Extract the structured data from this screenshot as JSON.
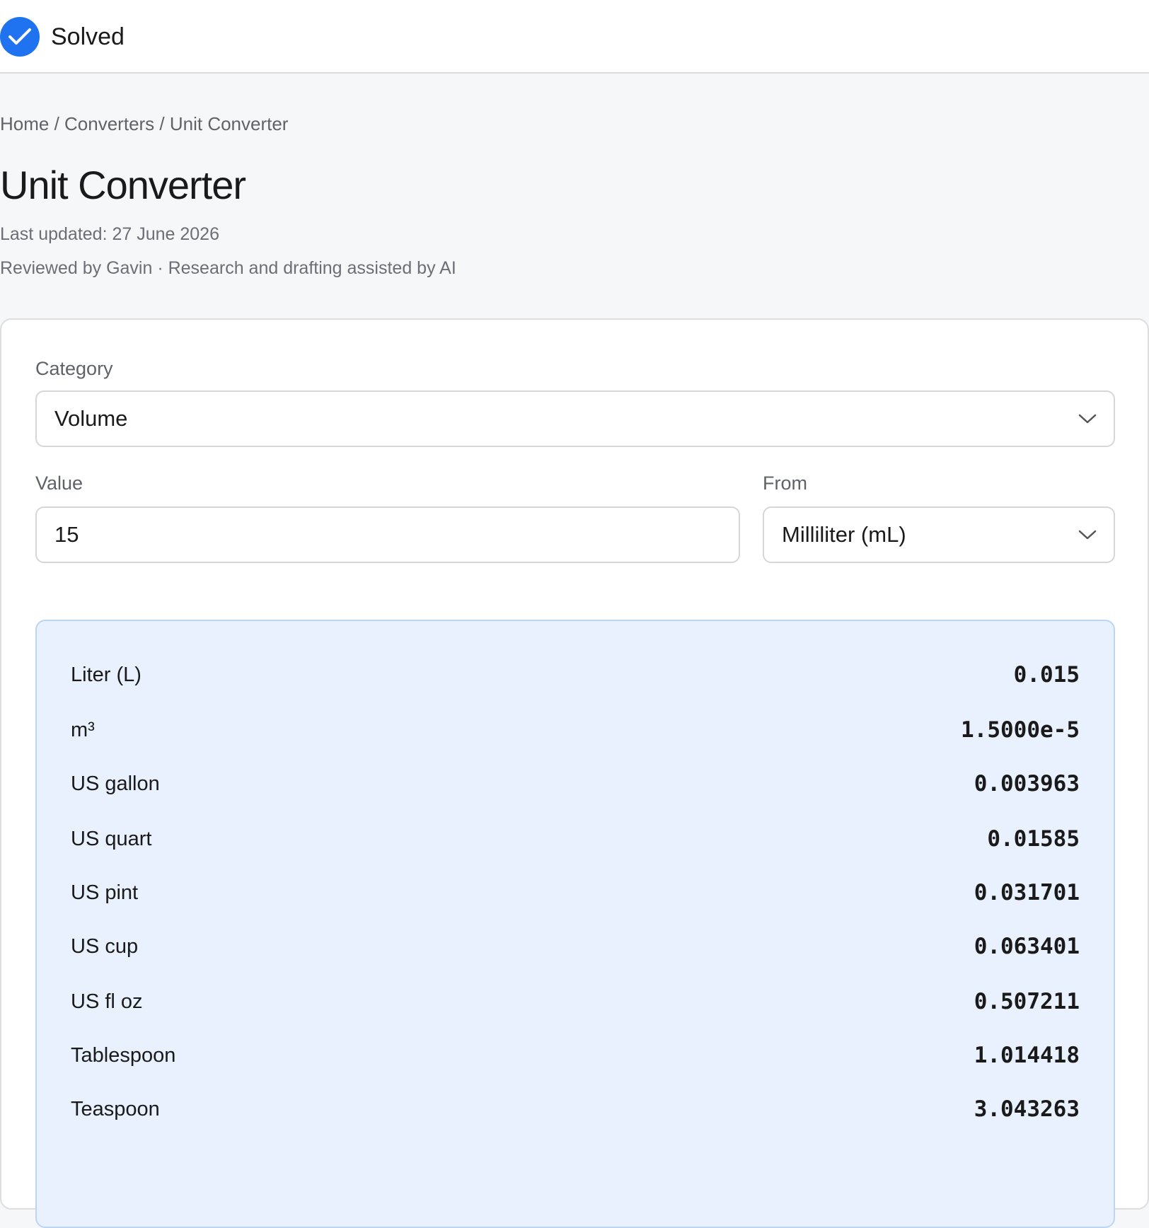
{
  "header": {
    "status_label": "Solved",
    "status_icon": "checkmark-circle-icon",
    "accent_color": "#1f73f0"
  },
  "breadcrumb": "Home / Converters / Unit Converter",
  "page": {
    "title": "Unit Converter",
    "last_updated": "Last updated: 27 June 2026",
    "reviewed_by": "Reviewed by Gavin · Research and drafting assisted by AI"
  },
  "converter": {
    "category_label": "Category",
    "category_value": "Volume",
    "value_label": "Value",
    "value": "15",
    "from_label": "From",
    "from_value": "Milliliter (mL)"
  },
  "results": [
    {
      "unit": "Liter (L)",
      "value": "0.015"
    },
    {
      "unit": "m³",
      "value": "1.5000e-5"
    },
    {
      "unit": "US gallon",
      "value": "0.003963"
    },
    {
      "unit": "US quart",
      "value": "0.01585"
    },
    {
      "unit": "US pint",
      "value": "0.031701"
    },
    {
      "unit": "US cup",
      "value": "0.063401"
    },
    {
      "unit": "US fl oz",
      "value": "0.507211"
    },
    {
      "unit": "Tablespoon",
      "value": "1.014418"
    },
    {
      "unit": "Teaspoon",
      "value": "3.043263"
    }
  ]
}
